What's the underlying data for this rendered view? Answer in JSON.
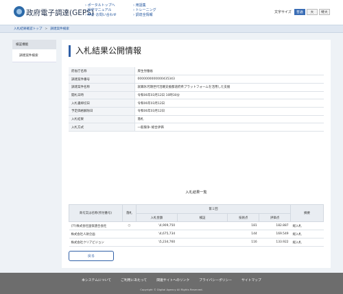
{
  "header": {
    "site_title": "政府電子調達(GEPS)",
    "links_col1": [
      "ポータルトップへ",
      "操作マニュアル",
      "FAQ･お問い合わせ"
    ],
    "links_col2": [
      "用語集",
      "トレーニング",
      "調達全情報"
    ],
    "font_size_label": "文字サイズ",
    "font_sizes": [
      {
        "label": "普通",
        "active": true
      },
      {
        "label": "大",
        "active": false
      },
      {
        "label": "特大",
        "active": false
      }
    ]
  },
  "breadcrumb": {
    "items": [
      "入札結果確認トップ",
      "調達案件検索"
    ],
    "separator": ">"
  },
  "sidebar": {
    "heading": "検証機能",
    "items": [
      "調達案件検索"
    ]
  },
  "main": {
    "title": "入札結果公開情報",
    "info_rows": [
      {
        "key": "府省庁名称",
        "value": "厚生労働省"
      },
      {
        "key": "調達案件番号",
        "value": "0000000000000435343"
      },
      {
        "key": "調達案件名称",
        "value": "就職氷河期世代活躍支援都道府県プラットフォームを活用した支援"
      },
      {
        "key": "開札日時",
        "value": "令和06年03月12日 10時30分"
      },
      {
        "key": "入札書締切日",
        "value": "令和06年03月12日"
      },
      {
        "key": "予定価格解除日",
        "value": "令和06年03月12日"
      },
      {
        "key": "入札結果",
        "value": "落札"
      },
      {
        "key": "入札方式",
        "value": "一般競争･総合評価"
      }
    ],
    "results_title": "入札結果一覧",
    "results_headers": {
      "company": "商号又は名称(所付番号)",
      "winner": "落札",
      "round": "第１回",
      "bid_amount": "入札金額",
      "verify": "検証",
      "tech_points": "技術点",
      "eval_points": "評価点",
      "note": "摘要"
    },
    "results_rows": [
      {
        "company": "(ｱﾃ)株式会社国保連合会社",
        "winner": "○",
        "amount": "\\4,909,750",
        "verify": "",
        "tech": "181",
        "eval": "182.887",
        "note": "総入札"
      },
      {
        "company": "株式会社人財企画",
        "winner": "",
        "amount": "\\4,675,734",
        "verify": "",
        "tech": "144",
        "eval": "169.549",
        "note": "総入札"
      },
      {
        "company": "株式会社クリアビジョン",
        "winner": "",
        "amount": "\\5,234,760",
        "verify": "",
        "tech": "116",
        "eval": "133.922",
        "note": "総入札"
      }
    ],
    "back_label": "戻る"
  },
  "footer": {
    "links": [
      "本システムについて",
      "ご利用にあたって",
      "関連サイトへのリンク",
      "プライバシーポリシー",
      "サイトマップ"
    ],
    "copyright": "Copyright © Digital Agency All Rights Reserved."
  }
}
